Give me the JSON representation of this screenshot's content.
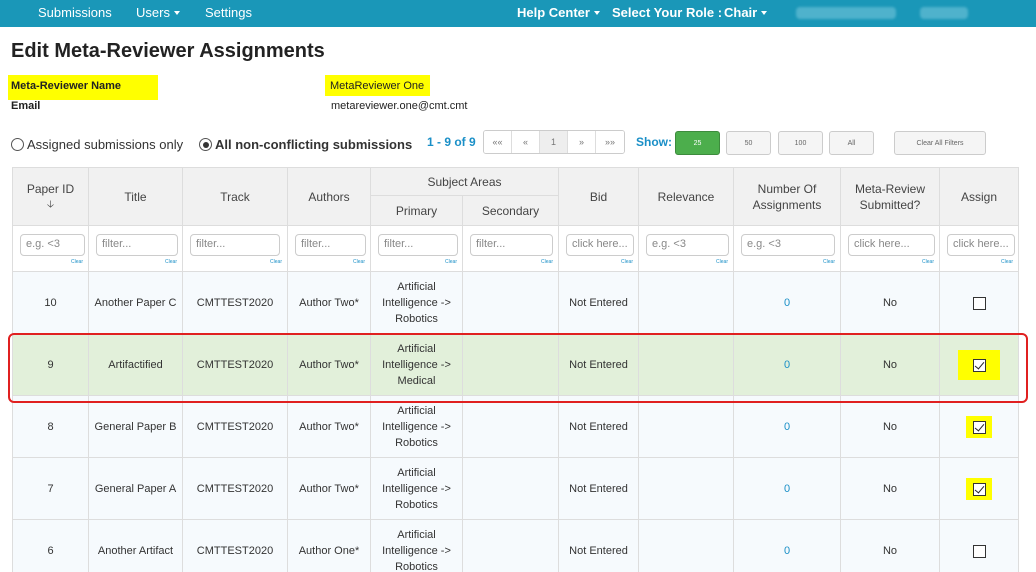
{
  "nav": {
    "submissions": "Submissions",
    "users": "Users",
    "settings": "Settings",
    "help_center": "Help Center",
    "role_label": "Select Your Role :",
    "role_value": "Chair"
  },
  "page_title": "Edit Meta-Reviewer Assignments",
  "info": {
    "name_label": "Meta-Reviewer Name",
    "name_value": "MetaReviewer One",
    "email_label": "Email",
    "email_value": "metareviewer.one@cmt.cmt"
  },
  "filter": {
    "radio_assigned": "Assigned submissions only",
    "radio_all": "All non-conflicting submissions",
    "page_count": "1 - 9 of 9",
    "pager": [
      "««",
      "«",
      "1",
      "»",
      "»»"
    ],
    "show_label": "Show:",
    "page_sizes": [
      "25",
      "50",
      "100",
      "All"
    ],
    "clear_all": "Clear All Filters"
  },
  "columns": {
    "paper_id": "Paper ID",
    "title": "Title",
    "track": "Track",
    "authors": "Authors",
    "subject_areas": "Subject Areas",
    "primary": "Primary",
    "secondary": "Secondary",
    "bid": "Bid",
    "relevance": "Relevance",
    "num_assign_1": "Number Of",
    "num_assign_2": "Assignments",
    "meta_review_1": "Meta-Review",
    "meta_review_2": "Submitted?",
    "assign": "Assign"
  },
  "filters": {
    "paper_id": "e.g. <3",
    "title": "filter...",
    "track": "filter...",
    "authors": "filter...",
    "primary": "filter...",
    "secondary": "filter...",
    "bid": "click here...",
    "relevance": "e.g. <3",
    "num_assign": "e.g. <3",
    "meta_review": "click here...",
    "assign": "click here...",
    "clear": "Clear"
  },
  "rows": [
    {
      "id": "10",
      "title": "Another Paper C",
      "track": "CMTTEST2020",
      "authors": "Author Two*",
      "primary_1": "Artificial",
      "primary_2": "Intelligence ->",
      "primary_3": "Robotics",
      "bid": "Not Entered",
      "num": "0",
      "meta": "No",
      "assigned": false
    },
    {
      "id": "9",
      "title": "Artifactified",
      "track": "CMTTEST2020",
      "authors": "Author Two*",
      "primary_1": "Artificial",
      "primary_2": "Intelligence ->",
      "primary_3": "Medical",
      "bid": "Not Entered",
      "num": "0",
      "meta": "No",
      "assigned": true
    },
    {
      "id": "8",
      "title": "General Paper B",
      "track": "CMTTEST2020",
      "authors": "Author Two*",
      "primary_1": "Artificial",
      "primary_2": "Intelligence ->",
      "primary_3": "Robotics",
      "bid": "Not Entered",
      "num": "0",
      "meta": "No",
      "assigned": true
    },
    {
      "id": "7",
      "title": "General Paper A",
      "track": "CMTTEST2020",
      "authors": "Author Two*",
      "primary_1": "Artificial",
      "primary_2": "Intelligence ->",
      "primary_3": "Robotics",
      "bid": "Not Entered",
      "num": "0",
      "meta": "No",
      "assigned": true
    },
    {
      "id": "6",
      "title": "Another Artifact",
      "track": "CMTTEST2020",
      "authors": "Author One*",
      "primary_1": "Artificial",
      "primary_2": "Intelligence ->",
      "primary_3": "Robotics",
      "bid": "Not Entered",
      "num": "0",
      "meta": "No",
      "assigned": false
    }
  ],
  "colors": {
    "navbar": "#1a97b8",
    "selected_row": "#e2f0da",
    "highlight": "#ffff00",
    "link": "#1a8fc7",
    "active_page_size": "#4cae4c",
    "selection_outline": "#e02020"
  }
}
